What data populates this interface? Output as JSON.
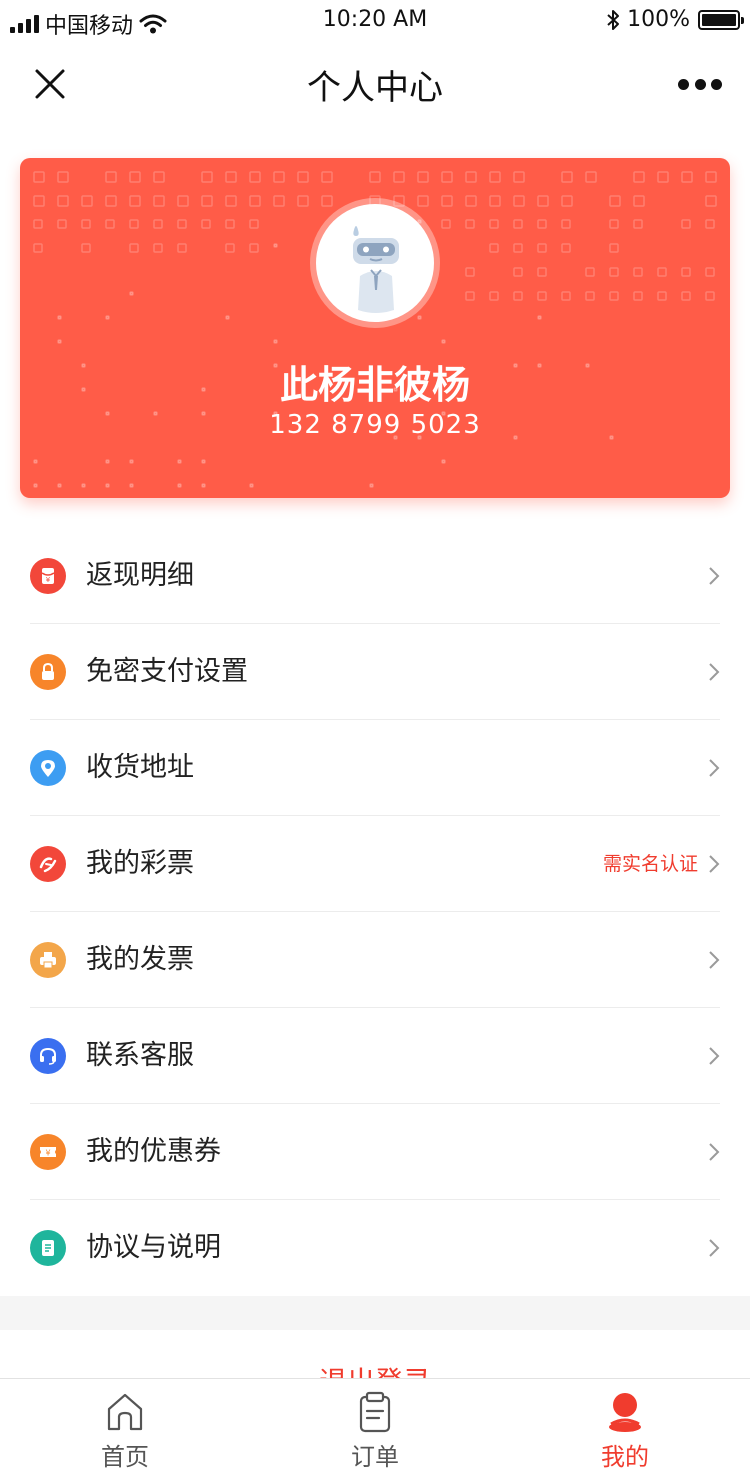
{
  "status_bar": {
    "carrier": "中国移动",
    "time": "10:20 AM",
    "battery": "100%"
  },
  "nav": {
    "title": "个人中心"
  },
  "profile": {
    "name": "此杨非彼杨",
    "phone": "132 8799 5023"
  },
  "menu": {
    "items": [
      {
        "label": "返现明细",
        "icon": "red-envelope-icon",
        "color": "#f2473a"
      },
      {
        "label": "免密支付设置",
        "icon": "lock-icon",
        "color": "#f7852a"
      },
      {
        "label": "收货地址",
        "icon": "location-pin-icon",
        "color": "#3d9df2"
      },
      {
        "label": "我的彩票",
        "icon": "lottery-icon",
        "color": "#f2473a",
        "note": "需实名认证"
      },
      {
        "label": "我的发票",
        "icon": "printer-icon",
        "color": "#f3a64a"
      },
      {
        "label": "联系客服",
        "icon": "headset-icon",
        "color": "#3a6ff0"
      },
      {
        "label": "我的优惠券",
        "icon": "coupon-icon",
        "color": "#f7852a"
      },
      {
        "label": "协议与说明",
        "icon": "document-icon",
        "color": "#1fb59c"
      }
    ]
  },
  "logout": {
    "label": "退出登录"
  },
  "tabbar": {
    "items": [
      {
        "label": "首页",
        "icon": "home-icon"
      },
      {
        "label": "订单",
        "icon": "order-icon"
      },
      {
        "label": "我的",
        "icon": "profile-icon"
      }
    ],
    "active": "我的"
  },
  "colors": {
    "accent": "#f03c2e",
    "card": "#ff5c48"
  }
}
